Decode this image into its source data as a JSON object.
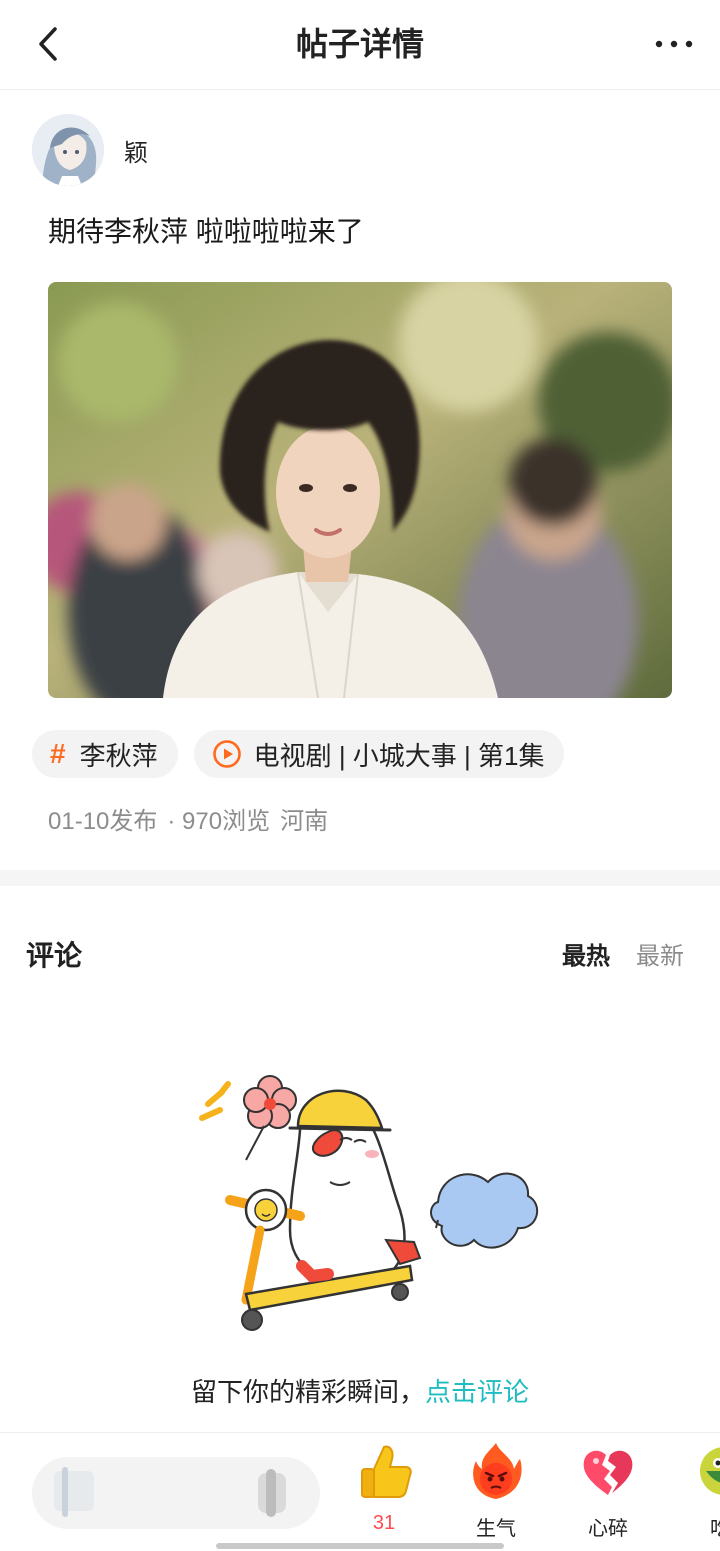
{
  "header": {
    "title": "帖子详情",
    "back_icon": "chevron-left-icon",
    "more_icon": "more-dots-icon"
  },
  "post": {
    "author_name": "颖",
    "text": "期待李秋萍 啦啦啦啦来了",
    "tags": [
      {
        "icon": "hash-icon",
        "label": "李秋萍"
      },
      {
        "icon": "play-circle-icon",
        "label": "电视剧 | 小城大事 | 第1集"
      }
    ],
    "meta": {
      "date": "01-10发布",
      "views": "· 970浏览",
      "location": "河南"
    }
  },
  "comments": {
    "title": "评论",
    "sort_hot": "最热",
    "sort_new": "最新",
    "empty_text": "留下你的精彩瞬间，",
    "empty_link": "点击评论"
  },
  "bottom_bar": {
    "reactions": [
      {
        "icon": "thumbs-up-icon",
        "label": "31"
      },
      {
        "icon": "angry-fire-icon",
        "label": "生气"
      },
      {
        "icon": "broken-heart-icon",
        "label": "心碎"
      },
      {
        "icon": "eating-melon-icon",
        "label": "吃"
      }
    ]
  },
  "colors": {
    "accent_orange": "#ff6a1f",
    "link_teal": "#1fbcc0",
    "count_red": "#ff4d4f"
  }
}
